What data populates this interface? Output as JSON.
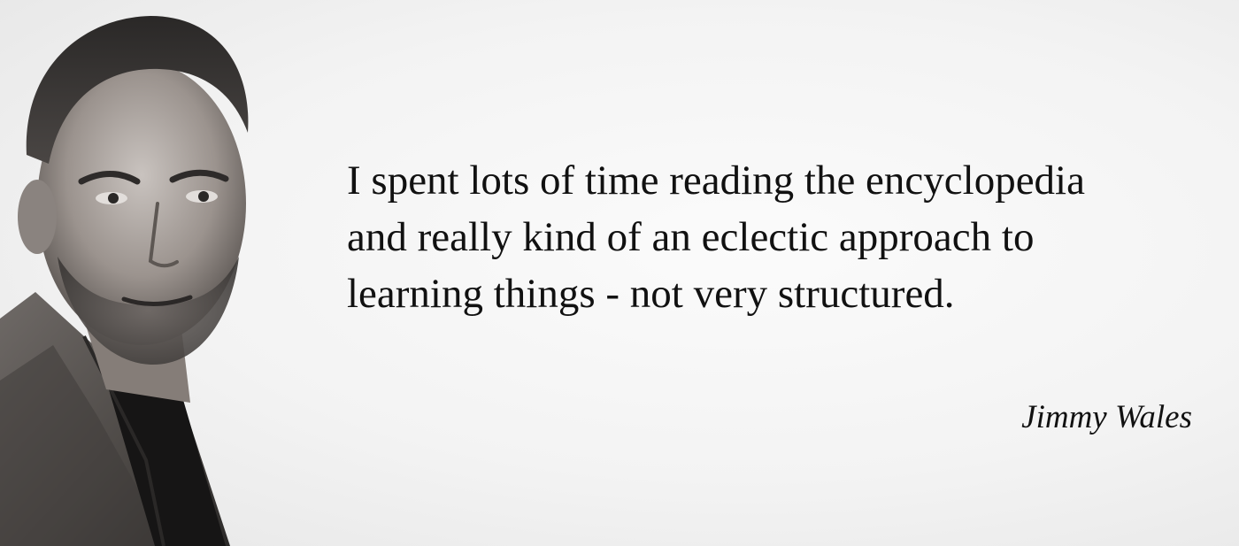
{
  "quote": {
    "lines": [
      "I spent lots of time reading the encyclopedia",
      "and really kind of an eclectic approach to",
      "learning things - not very structured."
    ]
  },
  "author": "Jimmy Wales",
  "colors": {
    "background": "#f3f3f3",
    "text": "#111111"
  },
  "portrait": {
    "style": "black-and-white photograph"
  }
}
